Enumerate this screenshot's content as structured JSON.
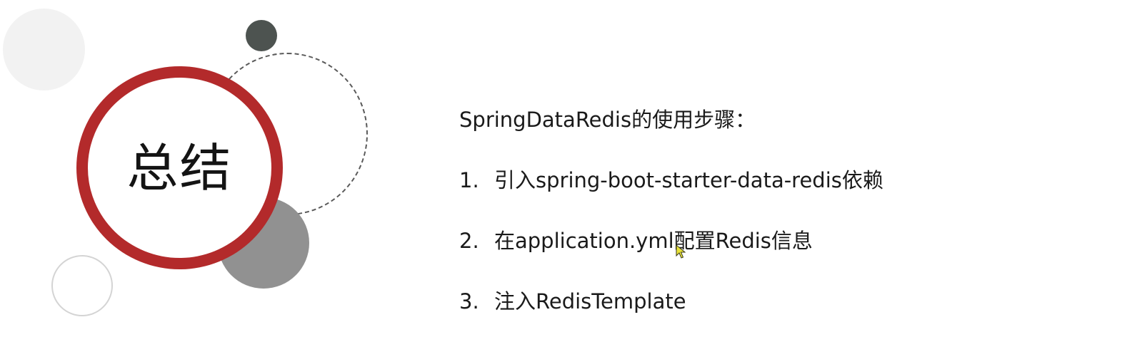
{
  "slide": {
    "title": "总结",
    "heading": "SpringDataRedis的使用步骤：",
    "steps": [
      {
        "number": "1.",
        "text": "引入spring-boot-starter-data-redis依赖"
      },
      {
        "number": "2.",
        "text": "在application.yml配置Redis信息"
      },
      {
        "number": "3.",
        "text": "注入RedisTemplate"
      }
    ]
  },
  "colors": {
    "accent": "#b32a2b",
    "dark_circle": "#4d5350",
    "gray_circle": "#919191",
    "light_circle": "#f2f2f2"
  },
  "icons": {
    "cursor": "mouse-pointer-icon"
  }
}
